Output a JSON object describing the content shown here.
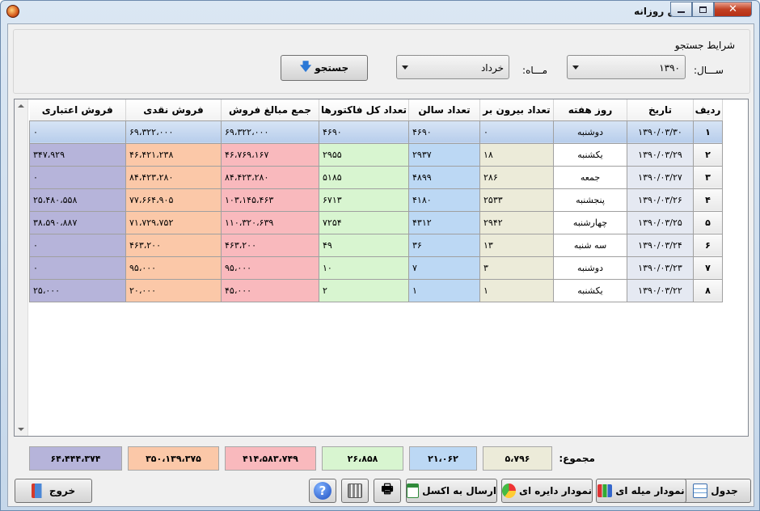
{
  "window": {
    "title": "گزارش فروش روزانه"
  },
  "search": {
    "legend": "شرایط جستجو",
    "year_label": "ســـال:",
    "year_value": "۱۳۹۰",
    "month_label": "مـــاه:",
    "month_value": "خرداد",
    "search_button": "جستجو"
  },
  "table": {
    "headers": [
      "ردیف",
      "تاریخ",
      "روز هفته",
      "تعداد بیرون بر",
      "تعداد سالن",
      "تعداد کل فاکتورها",
      "جمع مبالغ فروش",
      "فروش نقدی",
      "فروش اعتباری"
    ],
    "rows": [
      [
        "۱",
        "۱۳۹۰/۰۳/۳۰",
        "دوشنبه",
        "۰",
        "۴۶۹۰",
        "۴۶۹۰",
        "۶۹،۳۲۲،۰۰۰",
        "۶۹،۳۲۲،۰۰۰",
        "۰"
      ],
      [
        "۲",
        "۱۳۹۰/۰۳/۲۹",
        "یکشنبه",
        "۱۸",
        "۲۹۳۷",
        "۲۹۵۵",
        "۴۶،۷۶۹،۱۶۷",
        "۴۶،۴۲۱،۲۳۸",
        "۳۴۷،۹۲۹"
      ],
      [
        "۳",
        "۱۳۹۰/۰۳/۲۷",
        "جمعه",
        "۲۸۶",
        "۴۸۹۹",
        "۵۱۸۵",
        "۸۴،۴۲۳،۲۸۰",
        "۸۴،۴۲۳،۲۸۰",
        "۰"
      ],
      [
        "۴",
        "۱۳۹۰/۰۳/۲۶",
        "پنجشنبه",
        "۲۵۳۳",
        "۴۱۸۰",
        "۶۷۱۳",
        "۱۰۳،۱۴۵،۴۶۳",
        "۷۷،۶۶۴،۹۰۵",
        "۲۵،۴۸۰،۵۵۸"
      ],
      [
        "۵",
        "۱۳۹۰/۰۳/۲۵",
        "چهارشنبه",
        "۲۹۴۲",
        "۴۳۱۲",
        "۷۲۵۴",
        "۱۱۰،۳۲۰،۶۳۹",
        "۷۱،۷۲۹،۷۵۲",
        "۳۸،۵۹۰،۸۸۷"
      ],
      [
        "۶",
        "۱۳۹۰/۰۳/۲۴",
        "سه شنبه",
        "۱۳",
        "۳۶",
        "۴۹",
        "۴۶۳،۲۰۰",
        "۴۶۳،۲۰۰",
        "۰"
      ],
      [
        "۷",
        "۱۳۹۰/۰۳/۲۳",
        "دوشنبه",
        "۳",
        "۷",
        "۱۰",
        "۹۵،۰۰۰",
        "۹۵،۰۰۰",
        "۰"
      ],
      [
        "۸",
        "۱۳۹۰/۰۳/۲۲",
        "یکشنبه",
        "۱",
        "۱",
        "۲",
        "۴۵،۰۰۰",
        "۲۰،۰۰۰",
        "۲۵،۰۰۰"
      ]
    ]
  },
  "totals": {
    "label": "مجموع:",
    "out": "۵،۷۹۶",
    "hall": "۲۱،۰۶۲",
    "invoices": "۲۶،۸۵۸",
    "total": "۴۱۴،۵۸۳،۷۴۹",
    "cash": "۳۵۰،۱۳۹،۳۷۵",
    "credit": "۶۴،۴۴۴،۳۷۴"
  },
  "toolbar": {
    "table_button": "جدول",
    "bar_chart_button": "نمودار میله ای",
    "pie_chart_button": "نمودار دایره ای",
    "excel_button": "ارسال به اکسل",
    "exit_button": "خروج"
  },
  "colors": {
    "out": "#ecebd9",
    "hall": "#bcd8f4",
    "invoices": "#d8f5d0",
    "total": "#f9b9bd",
    "cash": "#fbc8a8",
    "credit": "#b6b4da"
  }
}
